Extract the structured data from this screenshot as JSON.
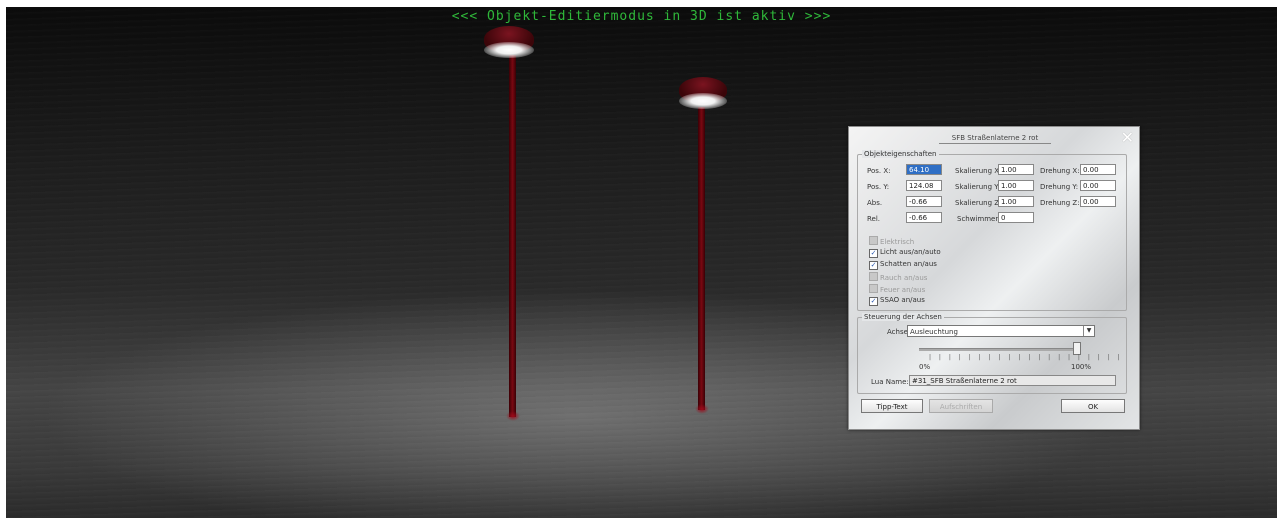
{
  "banner": "<<<  Objekt-Editiermodus in 3D ist aktiv  >>>",
  "dialog": {
    "title": "SFB Straßenlaterne 2 rot",
    "properties_group": "Objekteigenschaften",
    "pos_x_label": "Pos. X:",
    "pos_x_value": "64.10",
    "pos_y_label": "Pos. Y:",
    "pos_y_value": "124.08",
    "abs_label": "Abs.",
    "abs_value": "-0.66",
    "rel_label": "Rel.",
    "rel_value": "-0.66",
    "scale_x_label": "Skalierung X:",
    "scale_x_value": "1.00",
    "scale_y_label": "Skalierung Y:",
    "scale_y_value": "1.00",
    "scale_z_label": "Skalierung Z:",
    "scale_z_value": "1.00",
    "float_label": "Schwimmen:",
    "float_value": "0",
    "rot_x_label": "Drehung X:",
    "rot_x_value": "0.00",
    "rot_y_label": "Drehung Y:",
    "rot_y_value": "0.00",
    "rot_z_label": "Drehung Z:",
    "rot_z_value": "0.00",
    "checkboxes": [
      {
        "label": "Elektrisch",
        "checked": false,
        "enabled": false
      },
      {
        "label": "Licht aus/an/auto",
        "checked": true,
        "enabled": true
      },
      {
        "label": "Schatten an/aus",
        "checked": true,
        "enabled": true
      },
      {
        "label": "Rauch an/aus",
        "checked": false,
        "enabled": false
      },
      {
        "label": "Feuer an/aus",
        "checked": false,
        "enabled": false
      },
      {
        "label": "SSAO an/aus",
        "checked": true,
        "enabled": true
      }
    ],
    "axes_group": "Steuerung der Achsen",
    "axis_label": "Achse:",
    "axis_value": "Ausleuchtung",
    "slider_min": "0%",
    "slider_max": "100%",
    "slider_level": 1.0,
    "lua_label": "Lua Name:",
    "lua_value": "#31_SFB Straßenlaterne 2 rot",
    "tip_button": "Tipp-Text",
    "labels_button": "Aufschriften",
    "ok_button": "OK"
  }
}
